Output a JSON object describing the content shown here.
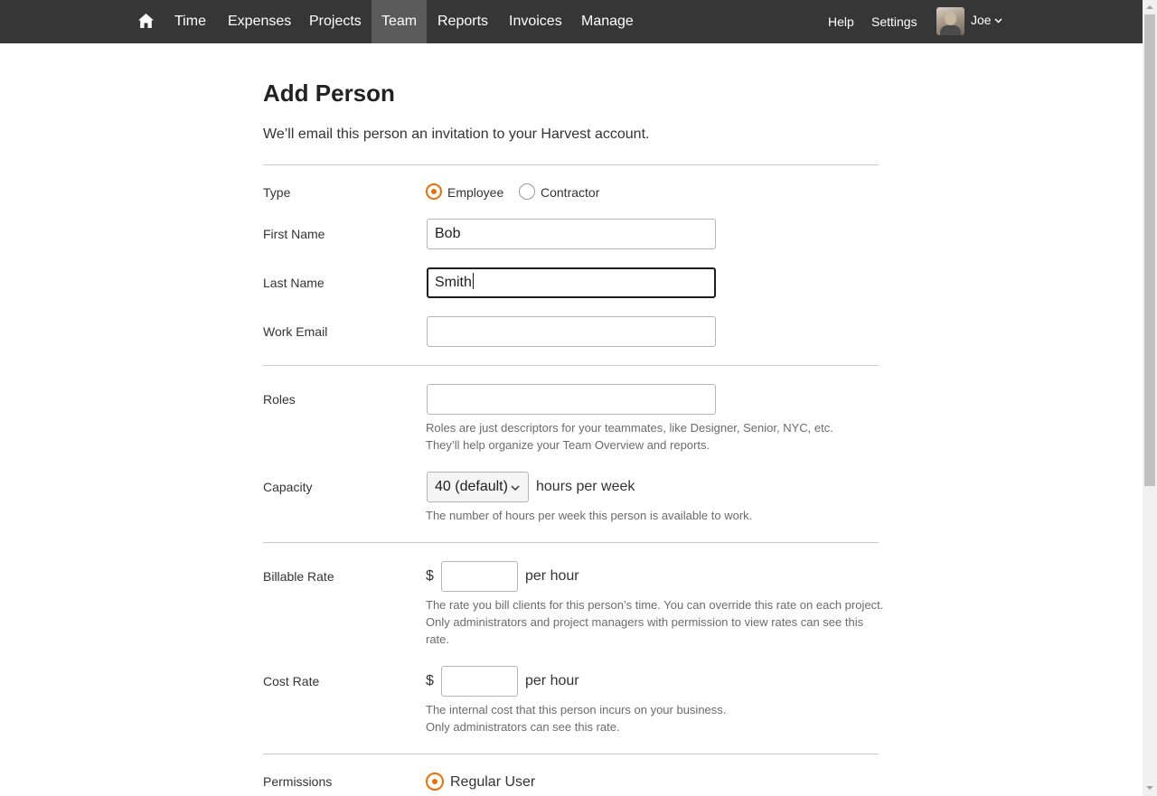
{
  "nav": {
    "items": [
      {
        "label": "Time"
      },
      {
        "label": "Expenses"
      },
      {
        "label": "Projects"
      },
      {
        "label": "Team"
      },
      {
        "label": "Reports"
      },
      {
        "label": "Invoices"
      },
      {
        "label": "Manage"
      }
    ],
    "active": "Team",
    "help": "Help",
    "settings": "Settings",
    "user": "Joe"
  },
  "page": {
    "title": "Add Person",
    "subtitle": "We’ll email this person an invitation to your Harvest account."
  },
  "form": {
    "type": {
      "label": "Type",
      "options": [
        "Employee",
        "Contractor"
      ],
      "selected": "Employee"
    },
    "first_name": {
      "label": "First Name",
      "value": "Bob"
    },
    "last_name": {
      "label": "Last Name",
      "value": "Smith"
    },
    "work_email": {
      "label": "Work Email",
      "value": ""
    },
    "roles": {
      "label": "Roles",
      "value": "",
      "hint_line1": "Roles are just descriptors for your teammates, like Designer, Senior, NYC, etc.",
      "hint_line2": "They’ll help organize your Team Overview and reports."
    },
    "capacity": {
      "label": "Capacity",
      "selected": "40 (default)",
      "suffix": "hours per week",
      "hint": "The number of hours per week this person is available to work."
    },
    "billable_rate": {
      "label": "Billable Rate",
      "currency": "$",
      "value": "",
      "suffix": "per hour",
      "hint_line1": "The rate you bill clients for this person’s time. You can override this rate on each project.",
      "hint_line2": "Only administrators and project managers with permission to view rates can see this",
      "hint_line3": "rate."
    },
    "cost_rate": {
      "label": "Cost Rate",
      "currency": "$",
      "value": "",
      "suffix": "per hour",
      "hint_line1": "The internal cost that this person incurs on your business.",
      "hint_line2": "Only administrators can see this rate."
    },
    "permissions": {
      "label": "Permissions",
      "first_option": "Regular User"
    }
  },
  "colors": {
    "nav_bg": "#363636",
    "nav_active_bg": "#5b5b5b",
    "accent": "#f36c00"
  }
}
